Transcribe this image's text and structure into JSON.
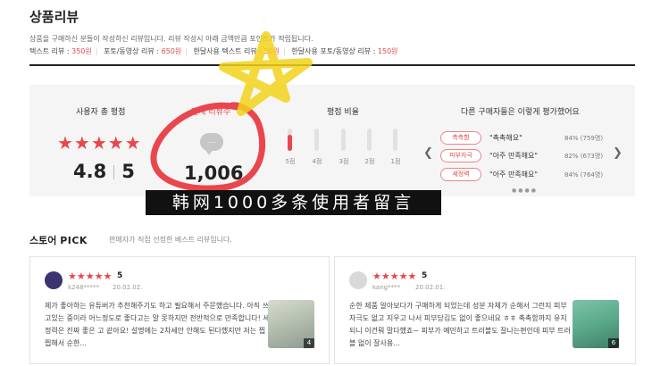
{
  "page": {
    "title": "상품리뷰",
    "description": "상품을 구매하신 분들이 작성하신 리뷰입니다. 리뷰 작성시 아래 금액만큼 포인트가 적립됩니다.",
    "rewards": [
      {
        "label": "텍스트 리뷰 : ",
        "amount": "350원"
      },
      {
        "label": "포토/동영상 리뷰 : ",
        "amount": "650원"
      },
      {
        "label": "한달사용 텍스트 리뷰 : ",
        "amount": "50원"
      },
      {
        "label": "한달사용 포토/동영상 리뷰 : ",
        "amount": "150원"
      }
    ]
  },
  "summary": {
    "avg_title": "사용자 총 평점",
    "stars": "★★★★★",
    "score": "4.8",
    "max": "5",
    "count_title": "전체 리뷰수",
    "bubble_icon": "...",
    "count": "1,006",
    "ratio_title": "평점 비율",
    "ratio": [
      {
        "label": "5점",
        "fraction": 0.35
      },
      {
        "label": "4점",
        "fraction": 0
      },
      {
        "label": "3점",
        "fraction": 0
      },
      {
        "label": "2점",
        "fraction": 0
      },
      {
        "label": "1점",
        "fraction": 0
      }
    ],
    "others_title": "다른 구매자들은 이렇게 평가했어요",
    "evaluations": [
      {
        "tag": "촉촉함",
        "text": "\"촉촉해요\"",
        "pct": "84% (759명)"
      },
      {
        "tag": "피부자극",
        "text": "\"아주 만족해요\"",
        "pct": "82% (673명)"
      },
      {
        "tag": "세정력",
        "text": "\"아주 만족해요\"",
        "pct": "84% (764명)"
      }
    ],
    "carousel_dots": "●●●●"
  },
  "caption": "韩网1000多条使用者留言",
  "store_pick": {
    "title_prefix": "스토어 ",
    "title_pick": "PICK",
    "subtitle": "판매자가 직접 선정한 베스트 리뷰입니다.",
    "reviews": [
      {
        "stars": "★★★★★",
        "rating": "5",
        "user": "k248*****",
        "date": "20.02.02.",
        "body": "제가 좋아하는 유튜버가 추천해주기도 하고 필요해서 주문했습니다. 아직 쓰고있는 중이라 어느정도로 좋다고는 말 못하지만 전반적으로 만족합니다! 세정력은 진짜 좋은 고 같아요! 설명에는 2차세안 안해도 된다했지만 저는 찝찝해서 순한...",
        "thumb_count": "4",
        "avatar_color": "#3a3570"
      },
      {
        "stars": "★★★★★",
        "rating": "5",
        "user": "kang****",
        "date": "20.02.01.",
        "body": "순한 제품 알아보다가 구매하게 되었는데 성분 자체가 순해서 그런지 피부 자극도 없고 지우고 나서 피부당김도 없이 좋으네요 ㅎㅎ 촉촉함까지 유지 되니 이건뭐 말다했죠~ 피부가 예민하고 트러블도 잘나는편인데 피부 트러블 없이 잘사용...",
        "thumb_count": "6",
        "avatar_color": "#d9d9d9"
      }
    ]
  },
  "colors": {
    "accent": "#e9464d",
    "highlight": "#f2d21b"
  }
}
